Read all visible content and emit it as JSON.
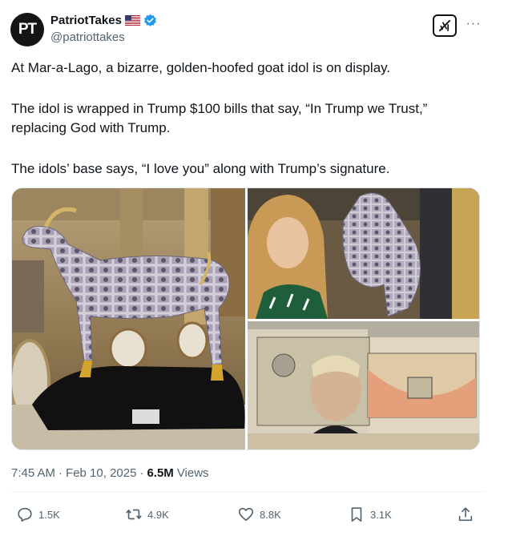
{
  "author": {
    "avatar_text": "PT",
    "display_name": "PatriotTakes",
    "handle": "@patriottakes",
    "flag_icon": "us-flag-icon",
    "verified_icon": "verified-badge-icon",
    "verified_color": "#1d9bf0"
  },
  "header_actions": {
    "grok_icon": "grok-icon",
    "more_label": "···"
  },
  "tweet": {
    "paragraph_1": "At Mar-a-Lago, a bizarre, golden-hoofed goat idol is on display.",
    "paragraph_2": "The idol is wrapped in Trump $100 bills that say, “In Trump we Trust,” replacing God with Trump.",
    "paragraph_3": "The idols’ base says, “I love you” along with Trump’s signature."
  },
  "media": {
    "images": [
      {
        "name": "goat-idol-photo"
      },
      {
        "name": "woman-with-goat-photo"
      },
      {
        "name": "trump-bill-closeup-photo"
      }
    ]
  },
  "meta": {
    "time": "7:45 AM",
    "separator": "·",
    "date": "Feb 10, 2025",
    "views_count": "6.5M",
    "views_label": "Views"
  },
  "actions": {
    "reply_count": "1.5K",
    "repost_count": "4.9K",
    "like_count": "8.8K",
    "bookmark_count": "3.1K"
  },
  "colors": {
    "text": "#0f1419",
    "secondary": "#536471",
    "divider": "#eff3f4"
  }
}
